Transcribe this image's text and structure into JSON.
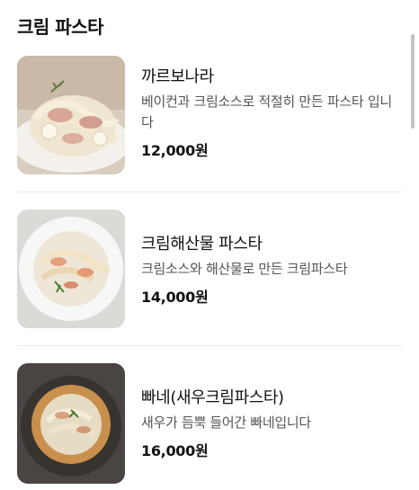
{
  "section": {
    "title": "크림 파스타"
  },
  "items": [
    {
      "name": "까르보나라",
      "description": "베이컨과 크림소스로 적절히 만든 파스타 입니다",
      "price": "12,000원",
      "image_icon": "carbonara-photo"
    },
    {
      "name": "크림해산물 파스타",
      "description": "크림소스와 해산물로 만든 크림파스타",
      "price": "14,000원",
      "image_icon": "seafood-cream-pasta-photo"
    },
    {
      "name": "빠네(새우크림파스타)",
      "description": "새우가 듬뿍 들어간 빠네입니다",
      "price": "16,000원",
      "image_icon": "panne-shrimp-pasta-photo"
    }
  ]
}
